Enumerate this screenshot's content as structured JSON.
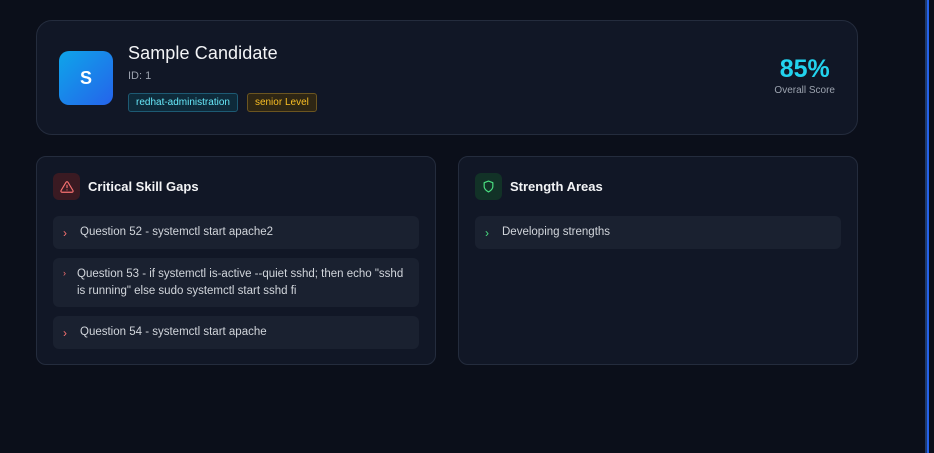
{
  "candidate": {
    "initial": "S",
    "name": "Sample Candidate",
    "id_text": "ID: 1",
    "tags": [
      "redhat-administration",
      "senior Level"
    ]
  },
  "score": {
    "value": "85%",
    "label": "Overall Score"
  },
  "skill_gaps": {
    "title": "Critical Skill Gaps",
    "icon": "alert-triangle-icon",
    "items": [
      "Question 52 - systemctl start apache2",
      "Question 53 - if systemctl is-active --quiet sshd; then echo \"sshd is running\" else sudo systemctl start sshd fi",
      "Question 54 - systemctl start apache"
    ]
  },
  "strengths": {
    "title": "Strength Areas",
    "icon": "shield-icon",
    "items": [
      "Developing strengths"
    ]
  },
  "colors": {
    "background": "#0b0f1a",
    "card": "#111726",
    "accent": "#22d3ee",
    "danger": "#f87171",
    "success": "#4ade80",
    "warning": "#fbbf24"
  }
}
